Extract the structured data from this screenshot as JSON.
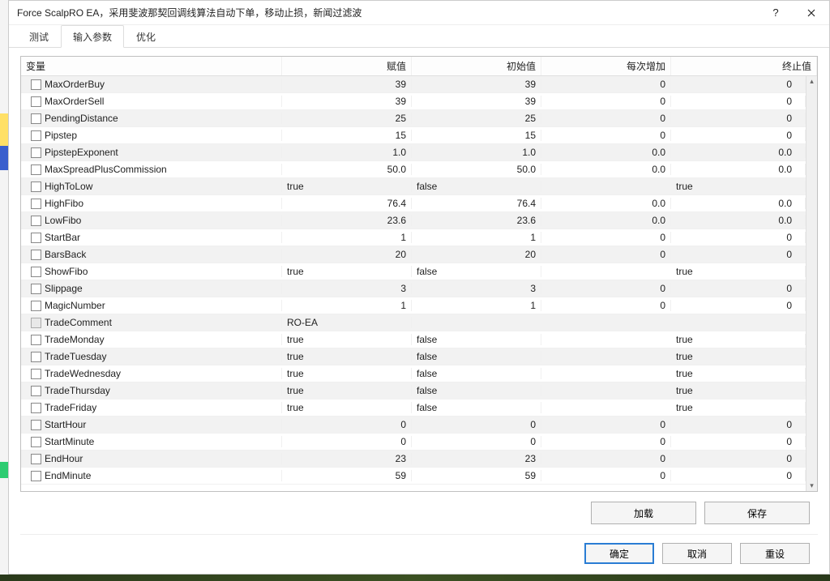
{
  "window": {
    "title": "Force ScalpRO EA，采用斐波那契回调线算法自动下单，移动止损，新闻过滤波"
  },
  "tabs": [
    {
      "label": "测试",
      "active": false
    },
    {
      "label": "输入参数",
      "active": true
    },
    {
      "label": "优化",
      "active": false
    }
  ],
  "columns": {
    "var": "变量",
    "val": "赋值",
    "ini": "初始值",
    "step": "每次增加",
    "end": "终止值"
  },
  "rows": [
    {
      "name": "MaxOrderBuy",
      "val": "39",
      "ini": "39",
      "step": "0",
      "end": "0",
      "alt": true
    },
    {
      "name": "MaxOrderSell",
      "val": "39",
      "ini": "39",
      "step": "0",
      "end": "0",
      "alt": false
    },
    {
      "name": "PendingDistance",
      "val": "25",
      "ini": "25",
      "step": "0",
      "end": "0",
      "alt": true
    },
    {
      "name": "Pipstep",
      "val": "15",
      "ini": "15",
      "step": "0",
      "end": "0",
      "alt": false
    },
    {
      "name": "PipstepExponent",
      "val": "1.0",
      "ini": "1.0",
      "step": "0.0",
      "end": "0.0",
      "alt": true
    },
    {
      "name": "MaxSpreadPlusCommission",
      "val": "50.0",
      "ini": "50.0",
      "step": "0.0",
      "end": "0.0",
      "alt": false
    },
    {
      "name": "HighToLow",
      "val": "true",
      "ini": "false",
      "step": "",
      "end": "true",
      "alt": true,
      "txtLeft": true
    },
    {
      "name": "HighFibo",
      "val": "76.4",
      "ini": "76.4",
      "step": "0.0",
      "end": "0.0",
      "alt": false
    },
    {
      "name": "LowFibo",
      "val": "23.6",
      "ini": "23.6",
      "step": "0.0",
      "end": "0.0",
      "alt": true
    },
    {
      "name": "StartBar",
      "val": "1",
      "ini": "1",
      "step": "0",
      "end": "0",
      "alt": false
    },
    {
      "name": "BarsBack",
      "val": "20",
      "ini": "20",
      "step": "0",
      "end": "0",
      "alt": true
    },
    {
      "name": "ShowFibo",
      "val": "true",
      "ini": "false",
      "step": "",
      "end": "true",
      "alt": false,
      "txtLeft": true
    },
    {
      "name": "Slippage",
      "val": "3",
      "ini": "3",
      "step": "0",
      "end": "0",
      "alt": true
    },
    {
      "name": "MagicNumber",
      "val": "1",
      "ini": "1",
      "step": "0",
      "end": "0",
      "alt": false
    },
    {
      "name": "TradeComment",
      "val": "RO-EA",
      "ini": "",
      "step": "",
      "end": "",
      "alt": true,
      "txtLeft": true,
      "disabled": true
    },
    {
      "name": "TradeMonday",
      "val": "true",
      "ini": "false",
      "step": "",
      "end": "true",
      "alt": false,
      "txtLeft": true
    },
    {
      "name": "TradeTuesday",
      "val": "true",
      "ini": "false",
      "step": "",
      "end": "true",
      "alt": true,
      "txtLeft": true
    },
    {
      "name": "TradeWednesday",
      "val": "true",
      "ini": "false",
      "step": "",
      "end": "true",
      "alt": false,
      "txtLeft": true
    },
    {
      "name": "TradeThursday",
      "val": "true",
      "ini": "false",
      "step": "",
      "end": "true",
      "alt": true,
      "txtLeft": true
    },
    {
      "name": "TradeFriday",
      "val": "true",
      "ini": "false",
      "step": "",
      "end": "true",
      "alt": false,
      "txtLeft": true
    },
    {
      "name": "StartHour",
      "val": "0",
      "ini": "0",
      "step": "0",
      "end": "0",
      "alt": true
    },
    {
      "name": "StartMinute",
      "val": "0",
      "ini": "0",
      "step": "0",
      "end": "0",
      "alt": false
    },
    {
      "name": "EndHour",
      "val": "23",
      "ini": "23",
      "step": "0",
      "end": "0",
      "alt": true
    },
    {
      "name": "EndMinute",
      "val": "59",
      "ini": "59",
      "step": "0",
      "end": "0",
      "alt": false
    }
  ],
  "buttons": {
    "load": "加载",
    "save": "保存",
    "ok": "确定",
    "cancel": "取消",
    "reset": "重设"
  }
}
